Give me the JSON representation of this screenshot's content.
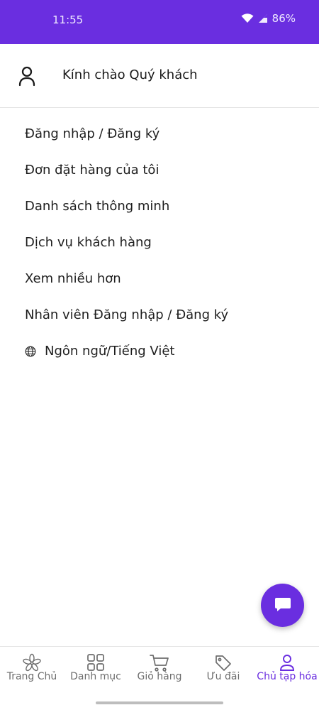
{
  "status_bar": {
    "time": "11:55",
    "battery": "86%",
    "wifi_icon": "wifi-icon",
    "signal_icon": "signal-icon"
  },
  "greeting": {
    "icon": "user-icon",
    "text": "Kính chào Quý khách"
  },
  "menu": {
    "items": [
      {
        "label": "Đăng nhập / Đăng ký"
      },
      {
        "label": "Đơn đặt hàng của tôi"
      },
      {
        "label": "Danh sách thông minh"
      },
      {
        "label": "Dịch vụ khách hàng"
      },
      {
        "label": "Xem nhiều hơn"
      },
      {
        "label": "Nhân viên Đăng nhập / Đăng ký"
      },
      {
        "label": "Ngôn ngữ/Tiếng Việt",
        "icon": "globe-icon"
      }
    ]
  },
  "chat_button": {
    "icon": "chat-icon"
  },
  "bottom_nav": {
    "items": [
      {
        "label": "Trang Chủ",
        "icon": "flower-icon"
      },
      {
        "label": "Danh mục",
        "icon": "grid-icon"
      },
      {
        "label": "Giỏ hàng",
        "icon": "cart-icon"
      },
      {
        "label": "Ưu đãi",
        "icon": "tag-icon"
      },
      {
        "label": "Chủ tạp hóa",
        "icon": "user-icon",
        "active": true
      }
    ]
  },
  "colors": {
    "accent": "#6a2ee0",
    "inactive": "#6d6d6d"
  }
}
